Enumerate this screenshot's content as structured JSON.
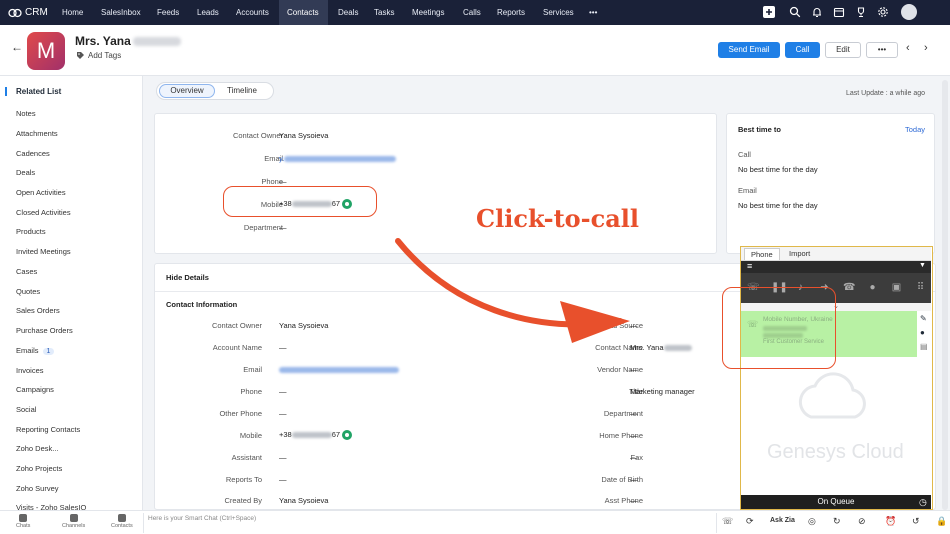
{
  "topnav": {
    "app_name": "CRM",
    "items": [
      "Home",
      "SalesInbox",
      "Feeds",
      "Leads",
      "Accounts",
      "Contacts",
      "Deals",
      "Tasks",
      "Meetings",
      "Calls",
      "Reports",
      "Services"
    ],
    "more": "•••",
    "active": "Contacts",
    "icons": [
      "plus-icon",
      "search-icon",
      "bell-icon",
      "calendar-icon",
      "trophy-icon",
      "grid-icon",
      "gear-icon",
      "avatar"
    ]
  },
  "header": {
    "back": "←",
    "avatar_letter": "M",
    "contact_name": "Mrs. Yana",
    "add_tags": "Add Tags",
    "buttons": {
      "send_email": "Send Email",
      "call": "Call",
      "edit": "Edit",
      "more": "•••"
    },
    "prev": "‹",
    "next": "›"
  },
  "sidebar": {
    "title": "Related List",
    "items": [
      "Notes",
      "Attachments",
      "Cadences",
      "Deals",
      "Open Activities",
      "Closed Activities",
      "Products",
      "Invited Meetings",
      "Cases",
      "Quotes",
      "Sales Orders",
      "Purchase Orders",
      "Emails",
      "Invoices",
      "Campaigns",
      "Social",
      "Reporting Contacts",
      "Zoho Desk...",
      "Zoho Projects",
      "Zoho Survey",
      "Visits - Zoho SalesIQ"
    ],
    "emails_badge": "1"
  },
  "tabs": {
    "overview": "Overview",
    "timeline": "Timeline"
  },
  "last_update": "Last Update : a while ago",
  "summary": {
    "fields": [
      {
        "label": "Contact Owner",
        "value": "Yana Sysoieva"
      },
      {
        "label": "Email",
        "value": "y.",
        "type": "email"
      },
      {
        "label": "Phone",
        "value": "—"
      },
      {
        "label": "Mobile",
        "value": "+38",
        "suffix": "67",
        "type": "mobile"
      },
      {
        "label": "Department",
        "value": "—"
      }
    ]
  },
  "best_time": {
    "title": "Best time to",
    "today": "Today",
    "call_label": "Call",
    "call_value": "No best time for the day",
    "email_label": "Email",
    "email_value": "No best time for the day"
  },
  "details": {
    "hide": "Hide Details",
    "section": "Contact Information",
    "left": [
      {
        "label": "Contact Owner",
        "value": "Yana Sysoieva"
      },
      {
        "label": "Account Name",
        "value": "—"
      },
      {
        "label": "Email",
        "value": "",
        "type": "email"
      },
      {
        "label": "Phone",
        "value": "—"
      },
      {
        "label": "Other Phone",
        "value": "—"
      },
      {
        "label": "Mobile",
        "value": "+38",
        "suffix": "67",
        "type": "mobile"
      },
      {
        "label": "Assistant",
        "value": "—"
      },
      {
        "label": "Reports To",
        "value": "—"
      },
      {
        "label": "Created By",
        "value": "Yana Sysoieva"
      }
    ],
    "right": [
      {
        "label": "Lead Source",
        "value": "—"
      },
      {
        "label": "Contact Name",
        "value": "Mrs. Yana"
      },
      {
        "label": "Vendor Name",
        "value": "—"
      },
      {
        "label": "Title",
        "value": "Marketing manager"
      },
      {
        "label": "Department",
        "value": "—"
      },
      {
        "label": "Home Phone",
        "value": "—"
      },
      {
        "label": "Fax",
        "value": "—"
      },
      {
        "label": "Date of Birth",
        "value": "—"
      },
      {
        "label": "Asst Phone",
        "value": "—"
      }
    ]
  },
  "annotation": {
    "text": "Click-to-call",
    "color": "#e8502c"
  },
  "phone_panel": {
    "tabs": [
      "Phone",
      "Import"
    ],
    "call_title": "Mobile Number, Ukraine",
    "call_sub": "First Customer Service",
    "brand": "Genesys Cloud",
    "status": "On Queue"
  },
  "bottombar": {
    "items": [
      "Chats",
      "Channels",
      "Contacts"
    ],
    "smart_chat": "Here is your Smart Chat (Ctrl+Space)",
    "ask_zia": "Ask Zia"
  },
  "colors": {
    "accent": "#1f7fe6",
    "nav": "#1a2138",
    "highlight": "#e8502c",
    "call_active": "#b8f1a4"
  }
}
